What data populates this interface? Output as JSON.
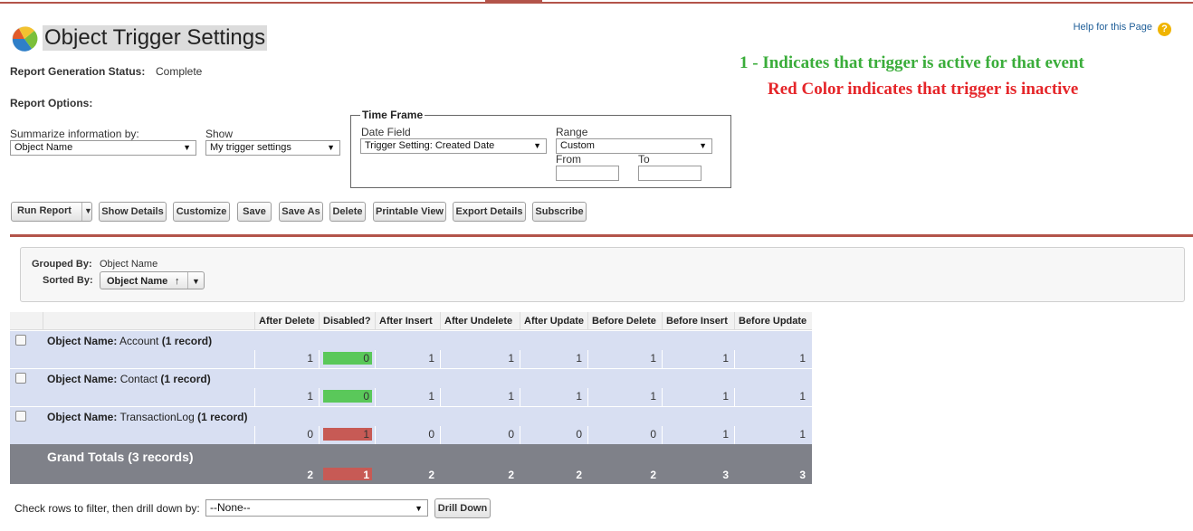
{
  "header": {
    "title": "Object Trigger Settings",
    "help_link": "Help for this Page",
    "help_icon": "question-icon"
  },
  "notes": {
    "active": "1 - Indicates that trigger is active for that event",
    "inactive": "Red Color indicates that trigger is inactive",
    "active_color": "#3aad3a",
    "inactive_color": "#e5262a"
  },
  "status": {
    "label": "Report Generation Status:",
    "value": "Complete"
  },
  "options": {
    "heading": "Report Options:",
    "summarize_label": "Summarize information by:",
    "summarize_value": "Object Name",
    "show_label": "Show",
    "show_value": "My trigger settings"
  },
  "time_frame": {
    "legend": "Time Frame",
    "date_field_label": "Date Field",
    "date_field_value": "Trigger Setting: Created Date",
    "range_label": "Range",
    "range_value": "Custom",
    "from_label": "From",
    "to_label": "To",
    "from_value": "",
    "to_value": ""
  },
  "toolbar": {
    "run_report": "Run Report",
    "show_details": "Show Details",
    "customize": "Customize",
    "save": "Save",
    "save_as": "Save As",
    "delete": "Delete",
    "printable_view": "Printable View",
    "export_details": "Export Details",
    "subscribe": "Subscribe"
  },
  "grouping": {
    "grouped_label": "Grouped By:",
    "grouped_value": "Object Name",
    "sorted_label": "Sorted By:",
    "sorted_value": "Object Name",
    "sort_arrow": "↑"
  },
  "table": {
    "columns": [
      "After Delete",
      "Disabled?",
      "After Insert",
      "After Undelete",
      "After Update",
      "Before Delete",
      "Before Insert",
      "Before Update"
    ],
    "rows": [
      {
        "label_prefix": "Object Name:",
        "name": "Account",
        "count": "(1 record)",
        "values": [
          "1",
          "0",
          "1",
          "1",
          "1",
          "1",
          "1",
          "1"
        ],
        "disabled_color": "#5ac85a"
      },
      {
        "label_prefix": "Object Name:",
        "name": "Contact",
        "count": "(1 record)",
        "values": [
          "1",
          "0",
          "1",
          "1",
          "1",
          "1",
          "1",
          "1"
        ],
        "disabled_color": "#5ac85a"
      },
      {
        "label_prefix": "Object Name:",
        "name": "TransactionLog",
        "count": "(1 record)",
        "values": [
          "0",
          "1",
          "0",
          "0",
          "0",
          "0",
          "1",
          "1"
        ],
        "disabled_color": "#c75a55"
      }
    ],
    "grand_total_label": "Grand Totals (3 records)",
    "grand_total_values": [
      "2",
      "1",
      "2",
      "2",
      "2",
      "2",
      "3",
      "3"
    ],
    "grand_disabled_color": "#c75a55"
  },
  "drill": {
    "label": "Check rows to filter, then drill down by:",
    "select_value": "--None--",
    "button": "Drill Down"
  }
}
